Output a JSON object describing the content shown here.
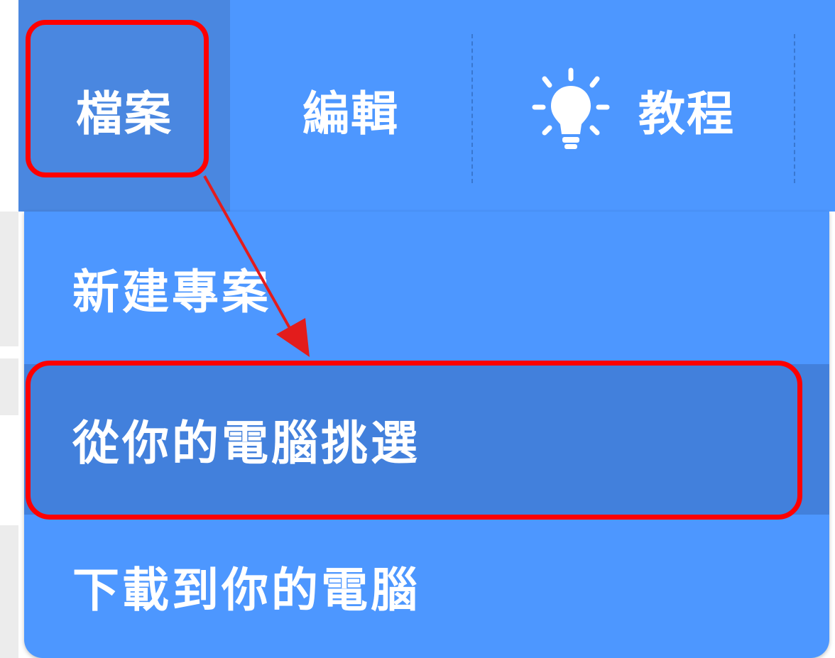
{
  "menubar": {
    "file_label": "檔案",
    "edit_label": "編輯",
    "tutorials_label": "教程",
    "tutorials_icon": "lightbulb-icon"
  },
  "file_menu": {
    "items": [
      {
        "label": "新建專案"
      },
      {
        "label": "從你的電腦挑選"
      },
      {
        "label": "下載到你的電腦"
      }
    ]
  },
  "colors": {
    "menu_blue": "#4d97ff",
    "active_blue": "#4a87e0",
    "hover_blue": "#4280dc",
    "annotation_red": "#ff0000"
  }
}
